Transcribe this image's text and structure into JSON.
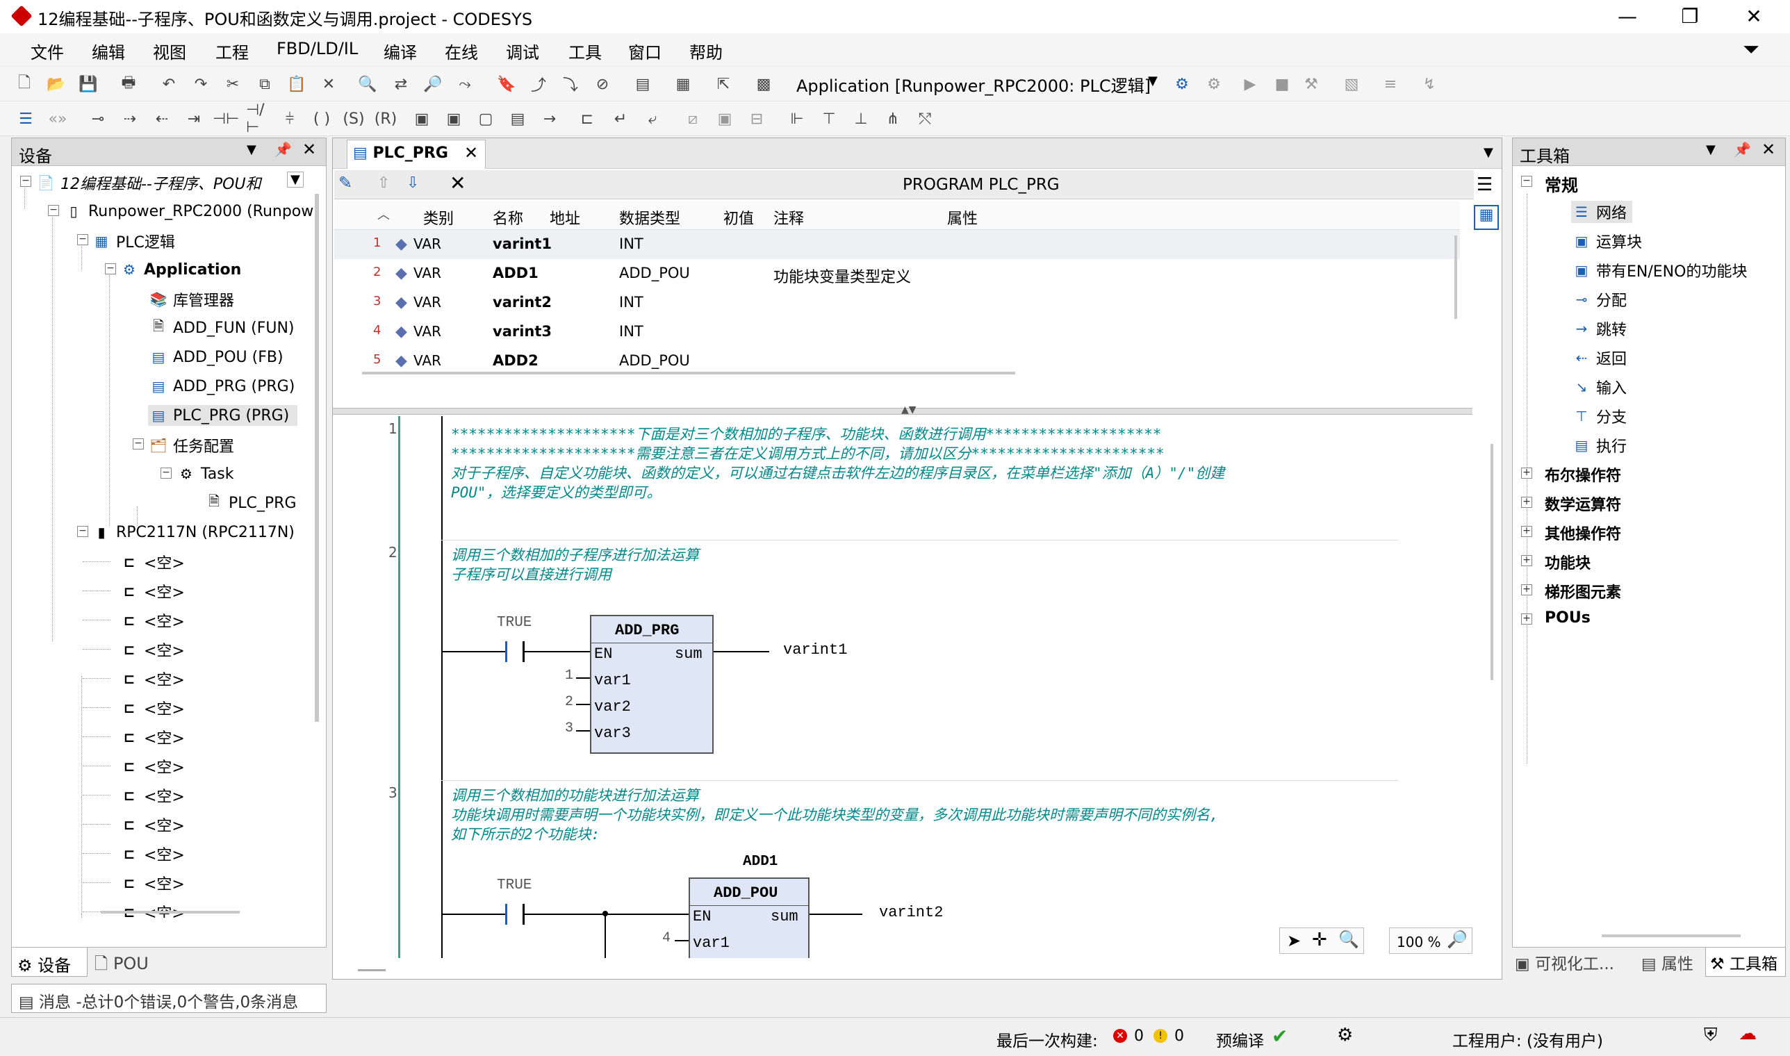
{
  "window": {
    "title": "12编程基础--子程序、POU和函数定义与调用.project - CODESYS",
    "minimize": "—",
    "maximize": "❐",
    "close": "✕"
  },
  "menu": [
    "文件",
    "编辑",
    "视图",
    "工程",
    "FBD/LD/IL",
    "编译",
    "在线",
    "调试",
    "工具",
    "窗口",
    "帮助"
  ],
  "toolbar": {
    "application_label": "Application [Runpower_RPC2000: PLC逻辑]"
  },
  "devices_panel": {
    "title": "设备",
    "tree": {
      "project": "12编程基础--子程序、POU和",
      "device": "Runpower_RPC2000 (Runpow",
      "plc_logic": "PLC逻辑",
      "application": "Application",
      "library_manager": "库管理器",
      "add_fun": "ADD_FUN (FUN)",
      "add_pou": "ADD_POU (FB)",
      "add_prg": "ADD_PRG (PRG)",
      "plc_prg": "PLC_PRG (PRG)",
      "task_config": "任务配置",
      "task": "Task",
      "task_plc_prg": "PLC_PRG",
      "rpc2117n": "RPC2117N (RPC2117N)",
      "empty_label": "<空>",
      "empty_count": 13
    },
    "tabs": {
      "devices": "设备",
      "pou": "POU"
    }
  },
  "messages_tab": "消息 -总计0个错误,0个警告,0条消息",
  "editor": {
    "tab_label": "PLC_PRG",
    "header_title": "PROGRAM PLC_PRG",
    "columns": [
      "类别",
      "名称",
      "地址",
      "数据类型",
      "初值",
      "注释",
      "属性"
    ],
    "variables": [
      {
        "num": "1",
        "kind": "VAR",
        "name": "varint1",
        "addr": "",
        "type": "INT",
        "init": "",
        "comment": "",
        "attr": ""
      },
      {
        "num": "2",
        "kind": "VAR",
        "name": "ADD1",
        "addr": "",
        "type": "ADD_POU",
        "init": "",
        "comment": "功能块变量类型定义",
        "attr": ""
      },
      {
        "num": "3",
        "kind": "VAR",
        "name": "varint2",
        "addr": "",
        "type": "INT",
        "init": "",
        "comment": "",
        "attr": ""
      },
      {
        "num": "4",
        "kind": "VAR",
        "name": "varint3",
        "addr": "",
        "type": "INT",
        "init": "",
        "comment": "",
        "attr": ""
      },
      {
        "num": "5",
        "kind": "VAR",
        "name": "ADD2",
        "addr": "",
        "type": "ADD_POU",
        "init": "",
        "comment": "",
        "attr": ""
      }
    ],
    "networks": [
      {
        "num": "1",
        "comment": "*********************下面是对三个数相加的子程序、功能块、函数进行调用********************\n*********************需要注意三者在定义调用方式上的不同，请加以区分**********************\n对于子程序、自定义功能块、函数的定义，可以通过右键点击软件左边的程序目录区，在菜单栏选择\"添加（A）\"/\"创建\nPOU\"，选择要定义的类型即可。"
      },
      {
        "num": "2",
        "comment": "调用三个数相加的子程序进行加法运算\n子程序可以直接进行调用",
        "contact": "TRUE",
        "block": "ADD_PRG",
        "en": "EN",
        "out": "sum",
        "out_var": "varint1",
        "inputs": [
          {
            "idx": "1",
            "name": "var1"
          },
          {
            "idx": "2",
            "name": "var2"
          },
          {
            "idx": "3",
            "name": "var3"
          }
        ]
      },
      {
        "num": "3",
        "comment": "调用三个数相加的功能块进行加法运算\n功能块调用时需要声明一个功能块实例，即定义一个此功能块类型的变量，多次调用此功能块时需要声明不同的实例名,\n如下所示的2个功能块:",
        "contact": "TRUE",
        "instance": "ADD1",
        "block": "ADD_POU",
        "en": "EN",
        "out": "sum",
        "out_var": "varint2",
        "inputs": [
          {
            "idx": "4",
            "name": "var1"
          }
        ]
      }
    ],
    "zoom": "100 %"
  },
  "toolbox": {
    "title": "工具箱",
    "general": "常规",
    "items": [
      "网络",
      "运算块",
      "带有EN/ENO的功能块",
      "分配",
      "跳转",
      "返回",
      "输入",
      "分支",
      "执行"
    ],
    "categories": [
      "布尔操作符",
      "数学运算符",
      "其他操作符",
      "功能块",
      "梯形图元素",
      "POUs"
    ],
    "tabs": {
      "visual": "可视化工...",
      "props": "属性",
      "toolbox": "工具箱"
    }
  },
  "statusbar": {
    "last_build": "最后一次构建:",
    "errors": "0",
    "warnings": "0",
    "precompile": "预编译",
    "user": "工程用户: (没有用户)"
  }
}
